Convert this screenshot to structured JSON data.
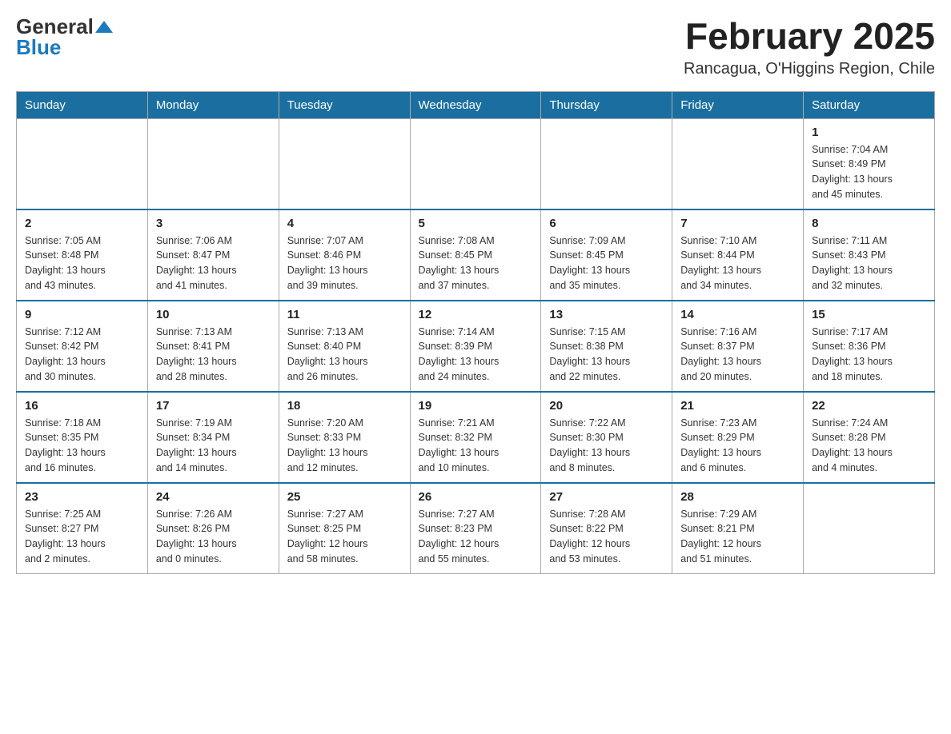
{
  "logo": {
    "general": "General",
    "blue": "Blue",
    "arrow_char": "▲"
  },
  "header": {
    "month_title": "February 2025",
    "location": "Rancagua, O'Higgins Region, Chile"
  },
  "weekdays": [
    "Sunday",
    "Monday",
    "Tuesday",
    "Wednesday",
    "Thursday",
    "Friday",
    "Saturday"
  ],
  "weeks": [
    [
      {
        "day": "",
        "info": ""
      },
      {
        "day": "",
        "info": ""
      },
      {
        "day": "",
        "info": ""
      },
      {
        "day": "",
        "info": ""
      },
      {
        "day": "",
        "info": ""
      },
      {
        "day": "",
        "info": ""
      },
      {
        "day": "1",
        "info": "Sunrise: 7:04 AM\nSunset: 8:49 PM\nDaylight: 13 hours\nand 45 minutes."
      }
    ],
    [
      {
        "day": "2",
        "info": "Sunrise: 7:05 AM\nSunset: 8:48 PM\nDaylight: 13 hours\nand 43 minutes."
      },
      {
        "day": "3",
        "info": "Sunrise: 7:06 AM\nSunset: 8:47 PM\nDaylight: 13 hours\nand 41 minutes."
      },
      {
        "day": "4",
        "info": "Sunrise: 7:07 AM\nSunset: 8:46 PM\nDaylight: 13 hours\nand 39 minutes."
      },
      {
        "day": "5",
        "info": "Sunrise: 7:08 AM\nSunset: 8:45 PM\nDaylight: 13 hours\nand 37 minutes."
      },
      {
        "day": "6",
        "info": "Sunrise: 7:09 AM\nSunset: 8:45 PM\nDaylight: 13 hours\nand 35 minutes."
      },
      {
        "day": "7",
        "info": "Sunrise: 7:10 AM\nSunset: 8:44 PM\nDaylight: 13 hours\nand 34 minutes."
      },
      {
        "day": "8",
        "info": "Sunrise: 7:11 AM\nSunset: 8:43 PM\nDaylight: 13 hours\nand 32 minutes."
      }
    ],
    [
      {
        "day": "9",
        "info": "Sunrise: 7:12 AM\nSunset: 8:42 PM\nDaylight: 13 hours\nand 30 minutes."
      },
      {
        "day": "10",
        "info": "Sunrise: 7:13 AM\nSunset: 8:41 PM\nDaylight: 13 hours\nand 28 minutes."
      },
      {
        "day": "11",
        "info": "Sunrise: 7:13 AM\nSunset: 8:40 PM\nDaylight: 13 hours\nand 26 minutes."
      },
      {
        "day": "12",
        "info": "Sunrise: 7:14 AM\nSunset: 8:39 PM\nDaylight: 13 hours\nand 24 minutes."
      },
      {
        "day": "13",
        "info": "Sunrise: 7:15 AM\nSunset: 8:38 PM\nDaylight: 13 hours\nand 22 minutes."
      },
      {
        "day": "14",
        "info": "Sunrise: 7:16 AM\nSunset: 8:37 PM\nDaylight: 13 hours\nand 20 minutes."
      },
      {
        "day": "15",
        "info": "Sunrise: 7:17 AM\nSunset: 8:36 PM\nDaylight: 13 hours\nand 18 minutes."
      }
    ],
    [
      {
        "day": "16",
        "info": "Sunrise: 7:18 AM\nSunset: 8:35 PM\nDaylight: 13 hours\nand 16 minutes."
      },
      {
        "day": "17",
        "info": "Sunrise: 7:19 AM\nSunset: 8:34 PM\nDaylight: 13 hours\nand 14 minutes."
      },
      {
        "day": "18",
        "info": "Sunrise: 7:20 AM\nSunset: 8:33 PM\nDaylight: 13 hours\nand 12 minutes."
      },
      {
        "day": "19",
        "info": "Sunrise: 7:21 AM\nSunset: 8:32 PM\nDaylight: 13 hours\nand 10 minutes."
      },
      {
        "day": "20",
        "info": "Sunrise: 7:22 AM\nSunset: 8:30 PM\nDaylight: 13 hours\nand 8 minutes."
      },
      {
        "day": "21",
        "info": "Sunrise: 7:23 AM\nSunset: 8:29 PM\nDaylight: 13 hours\nand 6 minutes."
      },
      {
        "day": "22",
        "info": "Sunrise: 7:24 AM\nSunset: 8:28 PM\nDaylight: 13 hours\nand 4 minutes."
      }
    ],
    [
      {
        "day": "23",
        "info": "Sunrise: 7:25 AM\nSunset: 8:27 PM\nDaylight: 13 hours\nand 2 minutes."
      },
      {
        "day": "24",
        "info": "Sunrise: 7:26 AM\nSunset: 8:26 PM\nDaylight: 13 hours\nand 0 minutes."
      },
      {
        "day": "25",
        "info": "Sunrise: 7:27 AM\nSunset: 8:25 PM\nDaylight: 12 hours\nand 58 minutes."
      },
      {
        "day": "26",
        "info": "Sunrise: 7:27 AM\nSunset: 8:23 PM\nDaylight: 12 hours\nand 55 minutes."
      },
      {
        "day": "27",
        "info": "Sunrise: 7:28 AM\nSunset: 8:22 PM\nDaylight: 12 hours\nand 53 minutes."
      },
      {
        "day": "28",
        "info": "Sunrise: 7:29 AM\nSunset: 8:21 PM\nDaylight: 12 hours\nand 51 minutes."
      },
      {
        "day": "",
        "info": ""
      }
    ]
  ]
}
